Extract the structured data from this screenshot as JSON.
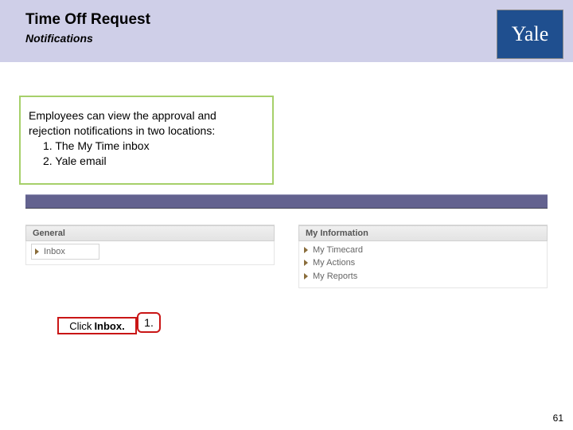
{
  "header": {
    "title": "Time Off Request",
    "subtitle": "Notifications",
    "logo_text": "Yale"
  },
  "info": {
    "line1": "Employees can view the approval and",
    "line2": "rejection notifications in two locations:",
    "item1": "1. The My Time inbox",
    "item2": "2. Yale email"
  },
  "panels": {
    "general": {
      "title": "General",
      "inbox": "Inbox"
    },
    "myinfo": {
      "title": "My Information",
      "items": [
        "My Timecard",
        "My Actions",
        "My Reports"
      ]
    }
  },
  "step": {
    "number": "1.",
    "text_prefix": "Click",
    "text_bold": "Inbox."
  },
  "page_number": "61"
}
